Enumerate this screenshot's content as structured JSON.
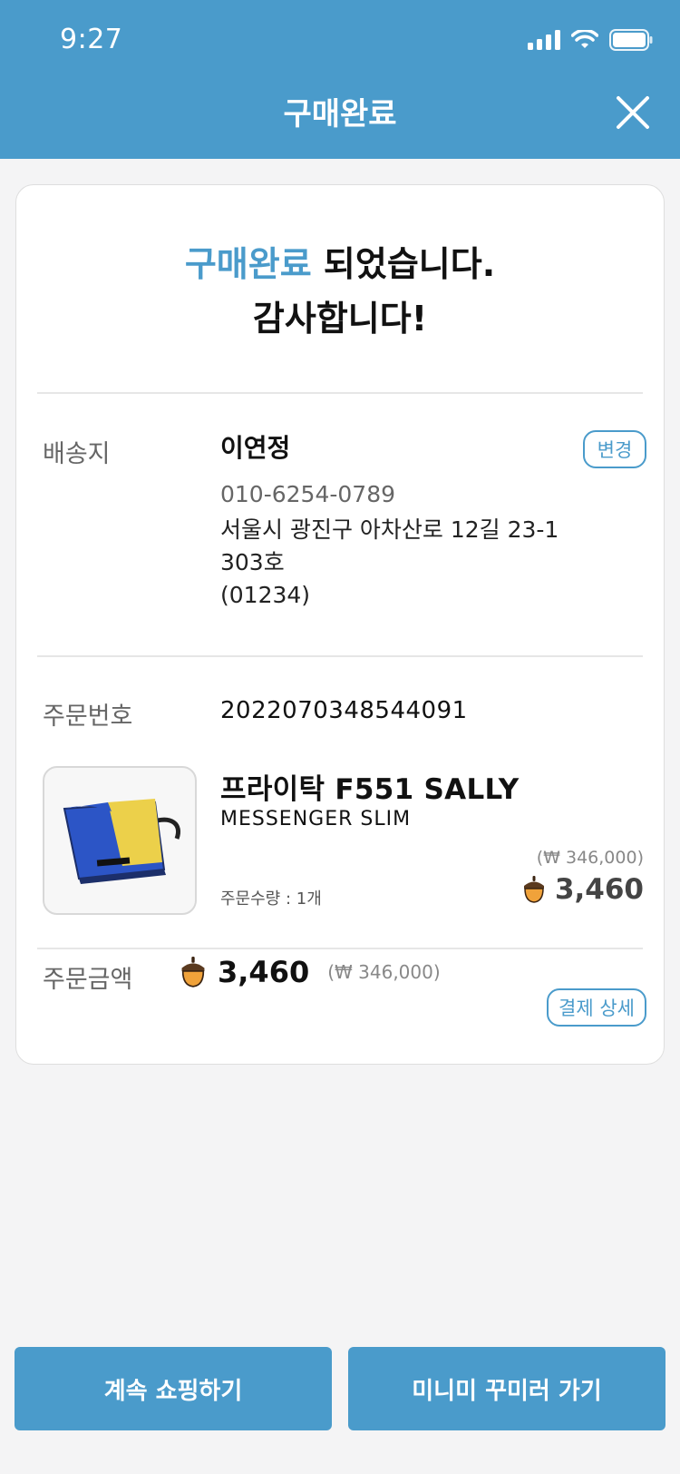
{
  "status_bar": {
    "time": "9:27"
  },
  "header": {
    "title": "구매완료"
  },
  "headline": {
    "accent": "구매완료",
    "line1_rest": " 되었습니다.",
    "line2": "감사합니다!"
  },
  "shipping": {
    "label": "배송지",
    "name": "이연정",
    "change_button": "변경",
    "phone": "010-6254-0789",
    "address_line1": "서울시 광진구 아차산로 12길 23-1",
    "address_line2": "303호",
    "postal": "(01234)"
  },
  "order": {
    "label": "주문번호",
    "number": "2022070348544091",
    "product_name": "프라이탁 F551 SALLY",
    "product_sub": "MESSENGER SLIM",
    "quantity": "주문수량 : 1개",
    "original_price": "(₩ 346,000)",
    "price": "3,460"
  },
  "total": {
    "label": "주문금액",
    "value": "3,460",
    "krw": "(₩ 346,000)",
    "detail_button": "결제 상세"
  },
  "buttons": {
    "continue": "계속 쇼핑하기",
    "go": "미니미 꾸미러 가기"
  },
  "colors": {
    "accent": "#4a9bcb",
    "acorn": "#f0a23a"
  }
}
